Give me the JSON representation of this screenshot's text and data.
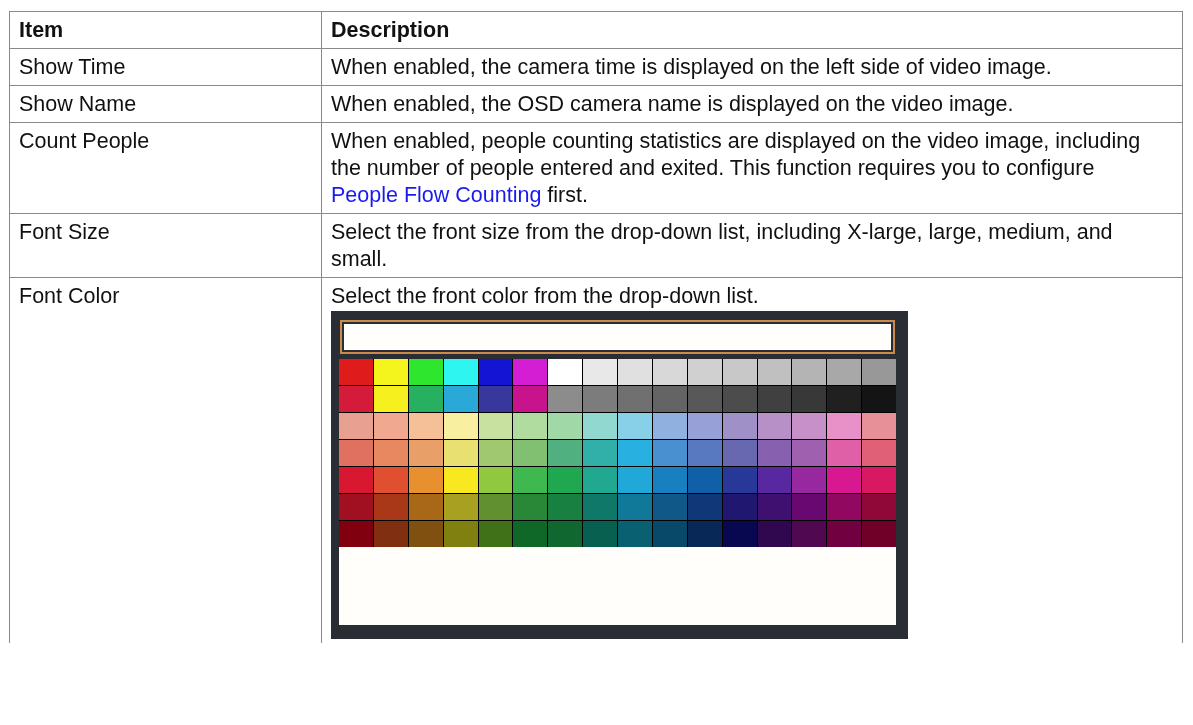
{
  "table": {
    "columns": [
      "Item",
      "Description"
    ],
    "rows": [
      {
        "item": "Show Time",
        "description": [
          {
            "kind": "text",
            "text": "When enabled, the camera time is displayed on the left side of video image."
          }
        ]
      },
      {
        "item": "Show Name",
        "description": [
          {
            "kind": "text",
            "text": "When enabled, the OSD camera name is displayed on the video image."
          }
        ]
      },
      {
        "item": "Count People",
        "description": [
          {
            "kind": "text",
            "text": "When enabled, people counting statistics are displayed on the video image, including the number of people entered and exited. This function requires you to configure "
          },
          {
            "kind": "link",
            "text": "People Flow Counting"
          },
          {
            "kind": "text",
            "text": " first."
          }
        ]
      },
      {
        "item": "Font Size",
        "description": [
          {
            "kind": "text",
            "text": "Select the front size from the drop-down list, including X-large, large, medium, and small."
          }
        ]
      },
      {
        "item": "Font Color",
        "description": [
          {
            "kind": "text",
            "text": "Select the front color from the drop-down list."
          }
        ],
        "color_palette": {
          "rows": [
            {
              "swatches": [
                {
                  "color": "#e01b1b"
                },
                {
                  "color": "#f5f51e"
                },
                {
                  "color": "#2ee62e"
                },
                {
                  "color": "#2ef5f0"
                },
                {
                  "color": "#1414d4"
                },
                {
                  "color": "#d41ed4"
                },
                {
                  "color": "#ffffff"
                },
                {
                  "color": "#e8e8e8"
                },
                {
                  "color": "#e0e0e0"
                },
                {
                  "color": "#d8d8d8"
                },
                {
                  "color": "#d0d0d0"
                },
                {
                  "color": "#c8c8c8"
                },
                {
                  "color": "#c0c0c0"
                },
                {
                  "color": "#b4b4b4"
                },
                {
                  "color": "#a8a8a8"
                },
                {
                  "color": "#989898"
                }
              ]
            },
            {
              "swatches": [
                {
                  "color": "#d41c3a"
                },
                {
                  "color": "#f5f01e"
                },
                {
                  "color": "#26b060"
                },
                {
                  "color": "#2aa8d8"
                },
                {
                  "color": "#38389c"
                },
                {
                  "color": "#c8148c"
                },
                {
                  "color": "#8c8c8c"
                },
                {
                  "color": "#7c7c7c"
                },
                {
                  "color": "#707070"
                },
                {
                  "color": "#646464"
                },
                {
                  "color": "#585858"
                },
                {
                  "color": "#4c4c4c"
                },
                {
                  "color": "#404040"
                },
                {
                  "color": "#383838"
                },
                {
                  "color": "#202020"
                },
                {
                  "color": "#141414"
                }
              ]
            },
            {
              "swatches": [
                {
                  "color": "#e8a090"
                },
                {
                  "color": "#f0a890"
                },
                {
                  "color": "#f5c098"
                },
                {
                  "color": "#f8f0a0"
                },
                {
                  "color": "#c8e0a0"
                },
                {
                  "color": "#b0dca0"
                },
                {
                  "color": "#a0d8a8"
                },
                {
                  "color": "#90d8d0"
                },
                {
                  "color": "#88d0e8"
                },
                {
                  "color": "#90b0e0"
                },
                {
                  "color": "#98a0d8"
                },
                {
                  "color": "#a090c8"
                },
                {
                  "color": "#b890c8"
                },
                {
                  "color": "#c890c8"
                },
                {
                  "color": "#e890c8"
                },
                {
                  "color": "#e89098"
                }
              ]
            },
            {
              "swatches": [
                {
                  "color": "#e07060"
                },
                {
                  "color": "#e88860"
                },
                {
                  "color": "#e8a068"
                },
                {
                  "color": "#e8e070"
                },
                {
                  "color": "#a0c870"
                },
                {
                  "color": "#80c070"
                },
                {
                  "color": "#50b080"
                },
                {
                  "color": "#30b0a8"
                },
                {
                  "color": "#28b0e0"
                },
                {
                  "color": "#4890d0"
                },
                {
                  "color": "#5878c0"
                },
                {
                  "color": "#6868b0"
                },
                {
                  "color": "#8860b0"
                },
                {
                  "color": "#a060b0"
                },
                {
                  "color": "#e060a8"
                },
                {
                  "color": "#e06078"
                }
              ]
            },
            {
              "swatches": [
                {
                  "color": "#d81830"
                },
                {
                  "color": "#e05030"
                },
                {
                  "color": "#e89030"
                },
                {
                  "color": "#f8e820"
                },
                {
                  "color": "#90c840"
                },
                {
                  "color": "#40b850"
                },
                {
                  "color": "#20a850"
                },
                {
                  "color": "#20a890"
                },
                {
                  "color": "#20a8d8"
                },
                {
                  "color": "#1880c0"
                },
                {
                  "color": "#1060a8"
                },
                {
                  "color": "#283898"
                },
                {
                  "color": "#5828a0"
                },
                {
                  "color": "#9828a0"
                },
                {
                  "color": "#d81890"
                },
                {
                  "color": "#d81860"
                }
              ]
            },
            {
              "swatches": [
                {
                  "color": "#a01020"
                },
                {
                  "color": "#a83818"
                },
                {
                  "color": "#a86818"
                },
                {
                  "color": "#a8a020"
                },
                {
                  "color": "#609030"
                },
                {
                  "color": "#288838"
                },
                {
                  "color": "#188040"
                },
                {
                  "color": "#107868"
                },
                {
                  "color": "#107898"
                },
                {
                  "color": "#105888"
                },
                {
                  "color": "#103878"
                },
                {
                  "color": "#201870"
                },
                {
                  "color": "#401070"
                },
                {
                  "color": "#680870"
                },
                {
                  "color": "#900860"
                },
                {
                  "color": "#900838"
                }
              ]
            },
            {
              "swatches": [
                {
                  "color": "#800010"
                },
                {
                  "color": "#803010"
                },
                {
                  "color": "#805010"
                },
                {
                  "color": "#808010"
                },
                {
                  "color": "#407018"
                },
                {
                  "color": "#106828"
                },
                {
                  "color": "#106830"
                },
                {
                  "color": "#086050"
                },
                {
                  "color": "#086070"
                },
                {
                  "color": "#084868"
                },
                {
                  "color": "#082858"
                },
                {
                  "color": "#080850"
                },
                {
                  "color": "#300850"
                },
                {
                  "color": "#500850"
                },
                {
                  "color": "#700040"
                },
                {
                  "color": "#700028"
                }
              ]
            }
          ]
        }
      }
    ]
  }
}
